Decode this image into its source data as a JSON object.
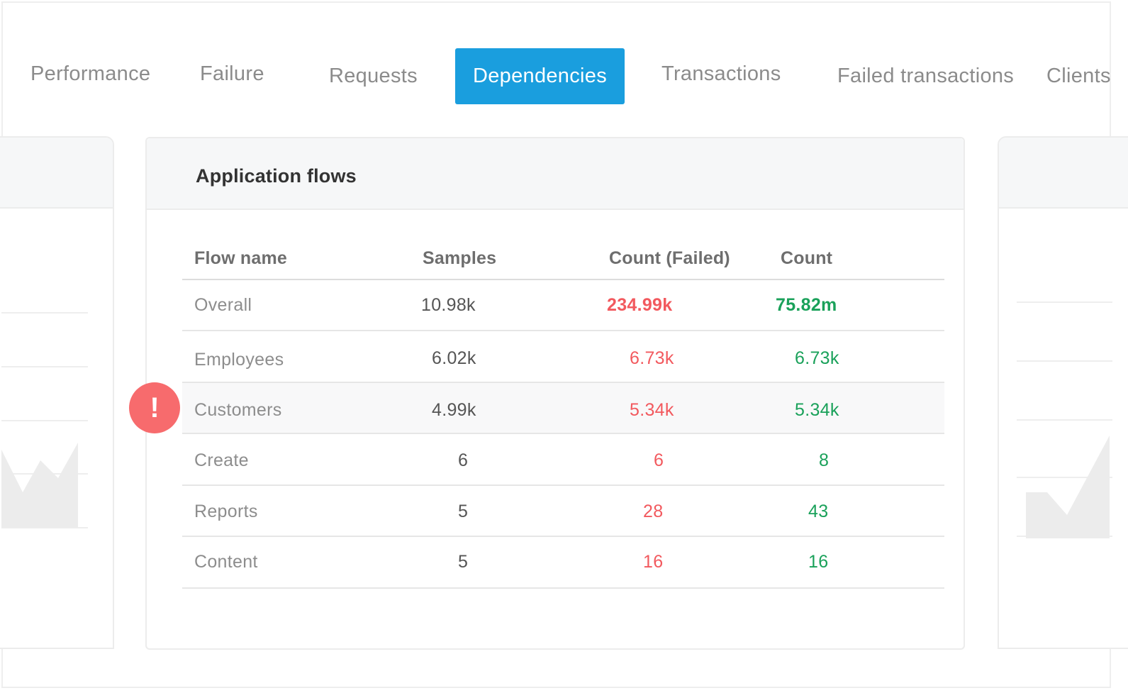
{
  "tabs": [
    {
      "label": "Performance",
      "active": false
    },
    {
      "label": "Failure",
      "active": false
    },
    {
      "label": "Requests",
      "active": false
    },
    {
      "label": "Dependencies",
      "active": true
    },
    {
      "label": "Transactions",
      "active": false
    },
    {
      "label": "Failed transactions",
      "active": false
    },
    {
      "label": "Clients",
      "active": false
    }
  ],
  "card": {
    "title": "Application flows",
    "columns": [
      "Flow name",
      "Samples",
      "Count (Failed)",
      "Count"
    ],
    "rows": [
      {
        "name": "Overall",
        "samples": "10.98k",
        "failed": "234.99k",
        "count": "75.82m"
      },
      {
        "name": "Employees",
        "samples": "6.02k",
        "failed": "6.73k",
        "count": "6.73k"
      },
      {
        "name": "Customers",
        "samples": "4.99k",
        "failed": "5.34k",
        "count": "5.34k",
        "alert": true
      },
      {
        "name": "Create",
        "samples": "6",
        "failed": "6",
        "count": "8"
      },
      {
        "name": "Reports",
        "samples": "5",
        "failed": "28",
        "count": "43"
      },
      {
        "name": "Content",
        "samples": "5",
        "failed": "16",
        "count": "16"
      }
    ]
  },
  "alert": {
    "symbol": "!",
    "icon": "alert-icon"
  },
  "colors": {
    "accent": "#1a9ede",
    "failed": "#f2595e",
    "count": "#1aa15a",
    "alert": "#f76b6d"
  }
}
